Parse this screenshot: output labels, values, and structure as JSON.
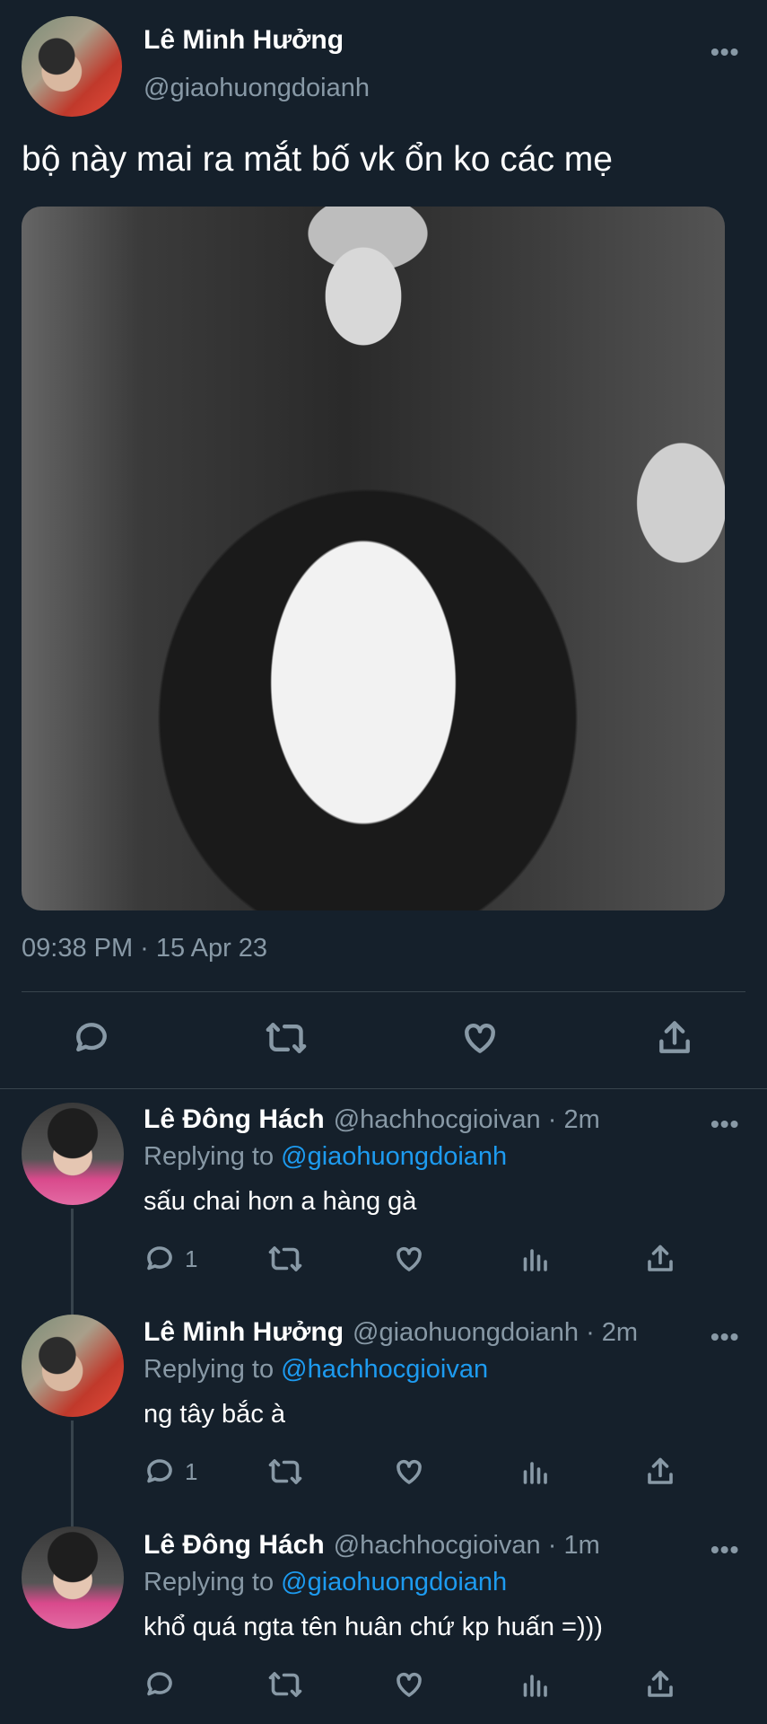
{
  "main_tweet": {
    "author_name": "Lê Minh Hưởng",
    "author_handle": "@giaohuongdoianh",
    "text": "bộ này mai ra mắt bố vk ổn ko các mẹ",
    "timestamp": "09:38 PM · 15 Apr 23",
    "more_label": "•••"
  },
  "replies": [
    {
      "name": "Lê Đông Hách",
      "handle": "@hachhocgioivan · 2m",
      "replying_prefix": "Replying to ",
      "replying_to": "@giaohuongdoianh",
      "text": "sấu chai hơn a hàng gà",
      "reply_count": "1"
    },
    {
      "name": "Lê Minh Hưởng",
      "handle": "@giaohuongdoianh · 2m",
      "replying_prefix": "Replying to ",
      "replying_to": "@hachhocgioivan",
      "text": "ng tây bắc à",
      "reply_count": "1"
    },
    {
      "name": "Lê Đông Hách",
      "handle": "@hachhocgioivan · 1m",
      "replying_prefix": "Replying to ",
      "replying_to": "@giaohuongdoianh",
      "text": "khổ quá ngta tên huân chứ kp huấn =)))",
      "reply_count": ""
    }
  ],
  "colors": {
    "background": "#15202b",
    "secondary_text": "#8899a6",
    "link": "#1d9bf0",
    "divider": "#38444d"
  },
  "icons": [
    "reply-icon",
    "retweet-icon",
    "like-icon",
    "share-icon",
    "analytics-icon",
    "more-icon"
  ]
}
